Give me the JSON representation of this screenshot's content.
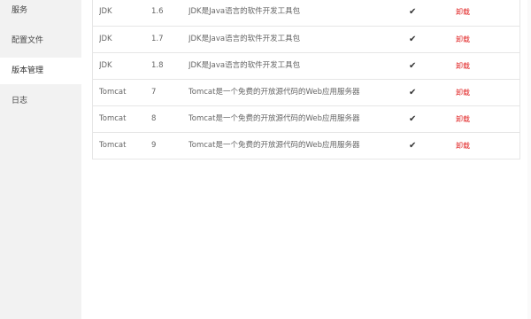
{
  "sidebar": {
    "items": [
      {
        "label": "服务"
      },
      {
        "label": "配置文件"
      },
      {
        "label": "版本管理"
      },
      {
        "label": "日志"
      }
    ]
  },
  "table": {
    "rows": [
      {
        "name": "JDK",
        "version": "1.6",
        "description": "JDK是Java语言的软件开发工具包",
        "check": "✔",
        "action": "卸载"
      },
      {
        "name": "JDK",
        "version": "1.7",
        "description": "JDK是Java语言的软件开发工具包",
        "check": "✔",
        "action": "卸载"
      },
      {
        "name": "JDK",
        "version": "1.8",
        "description": "JDK是Java语言的软件开发工具包",
        "check": "✔",
        "action": "卸载"
      },
      {
        "name": "Tomcat",
        "version": "7",
        "description": "Tomcat是一个免费的开放源代码的Web应用服务器",
        "check": "✔",
        "action": "卸载"
      },
      {
        "name": "Tomcat",
        "version": "8",
        "description": "Tomcat是一个免费的开放源代码的Web应用服务器",
        "check": "✔",
        "action": "卸载"
      },
      {
        "name": "Tomcat",
        "version": "9",
        "description": "Tomcat是一个免费的开放源代码的Web应用服务器",
        "check": "✔",
        "action": "卸载"
      }
    ]
  },
  "colors": {
    "sidebar_bg": "#f2f2f2",
    "action_red": "#e02020",
    "border": "#e6e6e6"
  }
}
